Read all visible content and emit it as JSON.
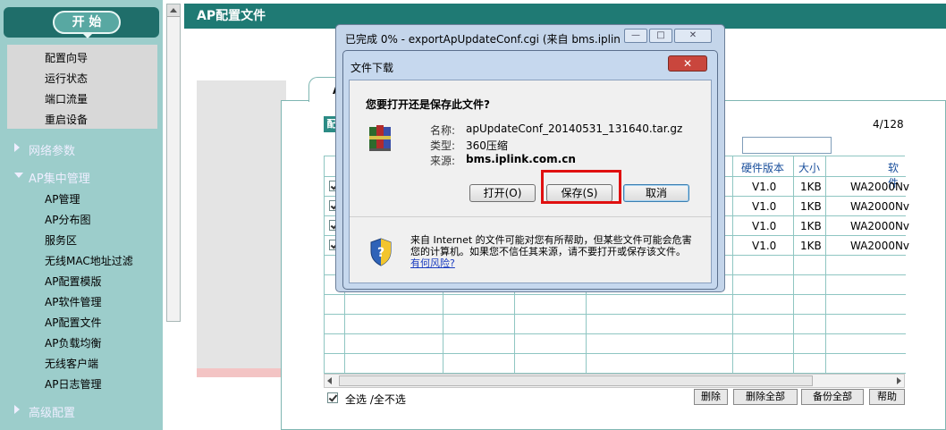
{
  "sidebar": {
    "start_label": "开 始",
    "system_items": [
      "配置向导",
      "运行状态",
      "端口流量",
      "重启设备"
    ],
    "groups": {
      "network": "网络参数",
      "ap": "AP集中管理",
      "advanced": "高级配置"
    },
    "ap_items": [
      "AP管理",
      "AP分布图",
      "服务区",
      "无线MAC地址过滤",
      "AP配置模版",
      "AP软件管理",
      "AP配置文件",
      "AP负载均衡",
      "无线客户端",
      "AP日志管理"
    ]
  },
  "main": {
    "header": "AP配置文件",
    "tab_char": "A",
    "tag_char": "配",
    "page_count": "4/128",
    "columns": [
      "硬件版本",
      "大小",
      "软件"
    ],
    "rows": [
      {
        "hw": "V1.0",
        "size": "1KB",
        "sw": "WA2000Nv"
      },
      {
        "hw": "V1.0",
        "size": "1KB",
        "sw": "WA2000Nv"
      },
      {
        "hw": "V1.0",
        "size": "1KB",
        "sw": "WA2000Nv"
      },
      {
        "hw": "V1.0",
        "size": "1KB",
        "sw": "WA2000Nv"
      }
    ],
    "select_all": "全选 /全不选",
    "buttons": {
      "delete": "删除",
      "delete_all": "删除全部",
      "backup_all": "备份全部",
      "help": "帮助"
    }
  },
  "progress_window": {
    "title": "已完成 0% - exportApUpdateConf.cgi (来自 bms.iplin",
    "min": "—",
    "max": "□",
    "close": "✕"
  },
  "download_dialog": {
    "title": "文件下载",
    "close": "✕",
    "question": "您要打开还是保存此文件?",
    "name_label": "名称:",
    "name_value": "apUpdateConf_20140531_131640.tar.gz",
    "type_label": "类型:",
    "type_value": "360压缩",
    "source_label": "来源:",
    "source_value": "bms.iplink.com.cn",
    "open_btn": "打开(O)",
    "save_btn": "保存(S)",
    "cancel_btn": "取消",
    "warning_text": "来自 Internet 的文件可能对您有所帮助，但某些文件可能会危害您的计算机。如果您不信任其来源，请不要打开或保存该文件。",
    "warning_link": "有何风险?"
  }
}
